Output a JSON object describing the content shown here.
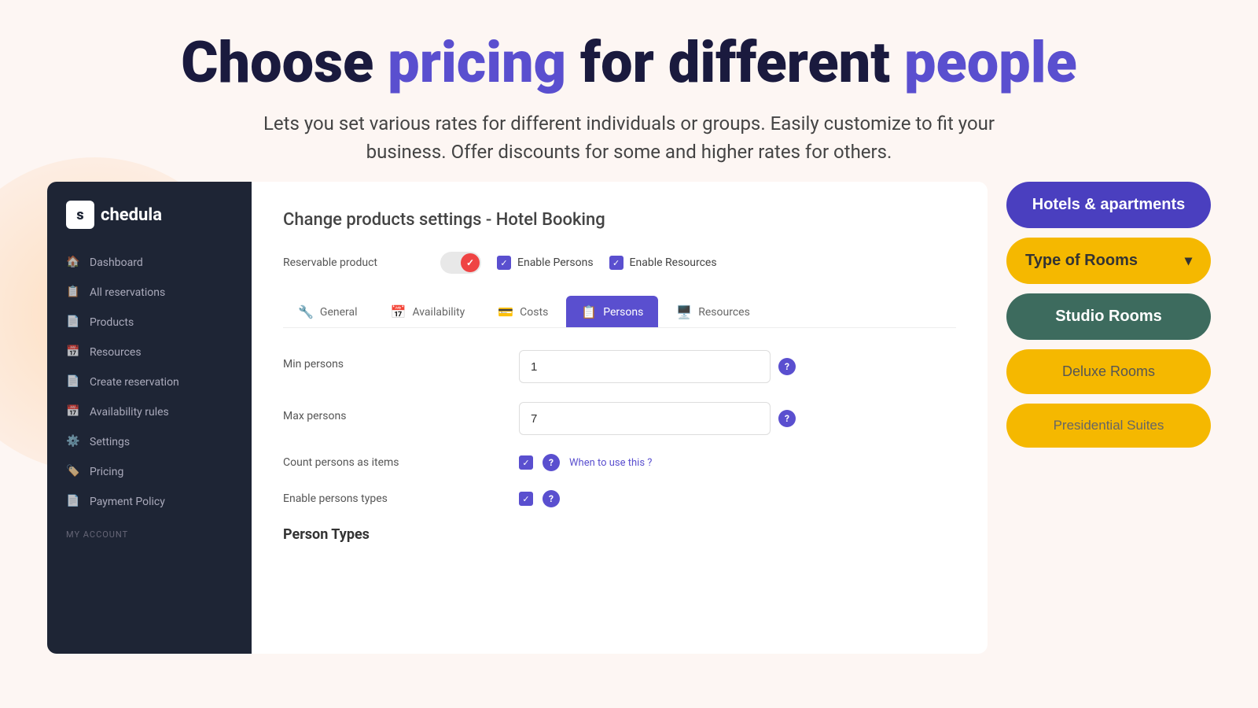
{
  "hero": {
    "title_part1": "Choose ",
    "title_accent": "pricing",
    "title_part2": " for different ",
    "title_accent2": "people",
    "subtitle": "Lets you set various rates for different individuals or groups. Easily customize to fit your business. Offer discounts for  some and higher rates for others."
  },
  "sidebar": {
    "logo_text": "chedula",
    "logo_letter": "s",
    "nav_items": [
      {
        "label": "Dashboard",
        "icon": "🏠"
      },
      {
        "label": "All reservations",
        "icon": "📋"
      },
      {
        "label": "Products",
        "icon": "📄"
      },
      {
        "label": "Resources",
        "icon": "📅"
      },
      {
        "label": "Create reservation",
        "icon": "📄"
      },
      {
        "label": "Availability rules",
        "icon": "📅"
      },
      {
        "label": "Settings",
        "icon": "⚙️"
      },
      {
        "label": "Pricing",
        "icon": "🏷️"
      },
      {
        "label": "Payment Policy",
        "icon": "📄"
      }
    ],
    "section_label": "MY ACCOUNT"
  },
  "content": {
    "page_title": "Change products settings - Hotel Booking",
    "reservable_label": "Reservable product",
    "enable_persons_label": "Enable Persons",
    "enable_resources_label": "Enable Resources",
    "tabs": [
      {
        "label": "General",
        "icon": "🔧",
        "active": false
      },
      {
        "label": "Availability",
        "icon": "📅",
        "active": false
      },
      {
        "label": "Costs",
        "icon": "💳",
        "active": false
      },
      {
        "label": "Persons",
        "icon": "📋",
        "active": true
      },
      {
        "label": "Resources",
        "icon": "🖥️",
        "active": false
      }
    ],
    "fields": [
      {
        "label": "Min persons",
        "value": "1",
        "name": "min-persons-input"
      },
      {
        "label": "Max persons",
        "value": "7",
        "name": "max-persons-input"
      }
    ],
    "count_persons_label": "Count persons as items",
    "when_to_use_label": "When to use this ?",
    "enable_persons_types_label": "Enable persons types",
    "person_types_title": "Person Types"
  },
  "right_panel": {
    "hotels_btn": "Hotels & apartments",
    "type_rooms_btn": "Type of Rooms",
    "studio_rooms_btn": "Studio Rooms",
    "deluxe_rooms_btn": "Deluxe Rooms",
    "presidential_btn": "Presidential Suites"
  }
}
